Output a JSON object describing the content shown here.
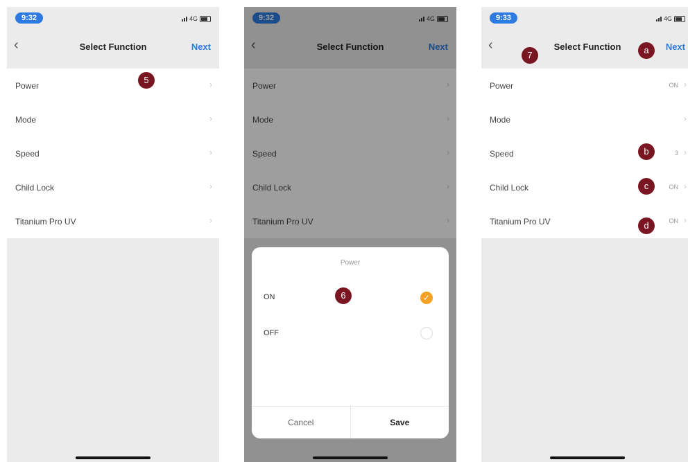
{
  "colors": {
    "accent": "#2d7be0",
    "check": "#f4a124",
    "badge": "#7a1622"
  },
  "phones": [
    {
      "time": "9:32",
      "network": "4G",
      "nav": {
        "back": "‹",
        "title": "Select Function",
        "next": "Next"
      },
      "rows": [
        {
          "label": "Power",
          "value": ""
        },
        {
          "label": "Mode",
          "value": ""
        },
        {
          "label": "Speed",
          "value": ""
        },
        {
          "label": "Child Lock",
          "value": ""
        },
        {
          "label": "Titanium Pro UV",
          "value": ""
        }
      ]
    },
    {
      "time": "9:32",
      "network": "4G",
      "nav": {
        "back": "‹",
        "title": "Select Function",
        "next": "Next"
      },
      "rows": [
        {
          "label": "Power",
          "value": ""
        },
        {
          "label": "Mode",
          "value": ""
        },
        {
          "label": "Speed",
          "value": ""
        },
        {
          "label": "Child Lock",
          "value": ""
        },
        {
          "label": "Titanium Pro UV",
          "value": ""
        }
      ],
      "sheet": {
        "title": "Power",
        "options": [
          {
            "label": "ON",
            "selected": true
          },
          {
            "label": "OFF",
            "selected": false
          }
        ],
        "cancel": "Cancel",
        "save": "Save"
      }
    },
    {
      "time": "9:33",
      "network": "4G",
      "nav": {
        "back": "‹",
        "title": "Select Function",
        "next": "Next"
      },
      "rows": [
        {
          "label": "Power",
          "value": "ON"
        },
        {
          "label": "Mode",
          "value": ""
        },
        {
          "label": "Speed",
          "value": "3"
        },
        {
          "label": "Child Lock",
          "value": "ON"
        },
        {
          "label": "Titanium Pro UV",
          "value": "ON"
        }
      ]
    }
  ],
  "badges": [
    "5",
    "6",
    "7",
    "a",
    "b",
    "c",
    "d"
  ]
}
